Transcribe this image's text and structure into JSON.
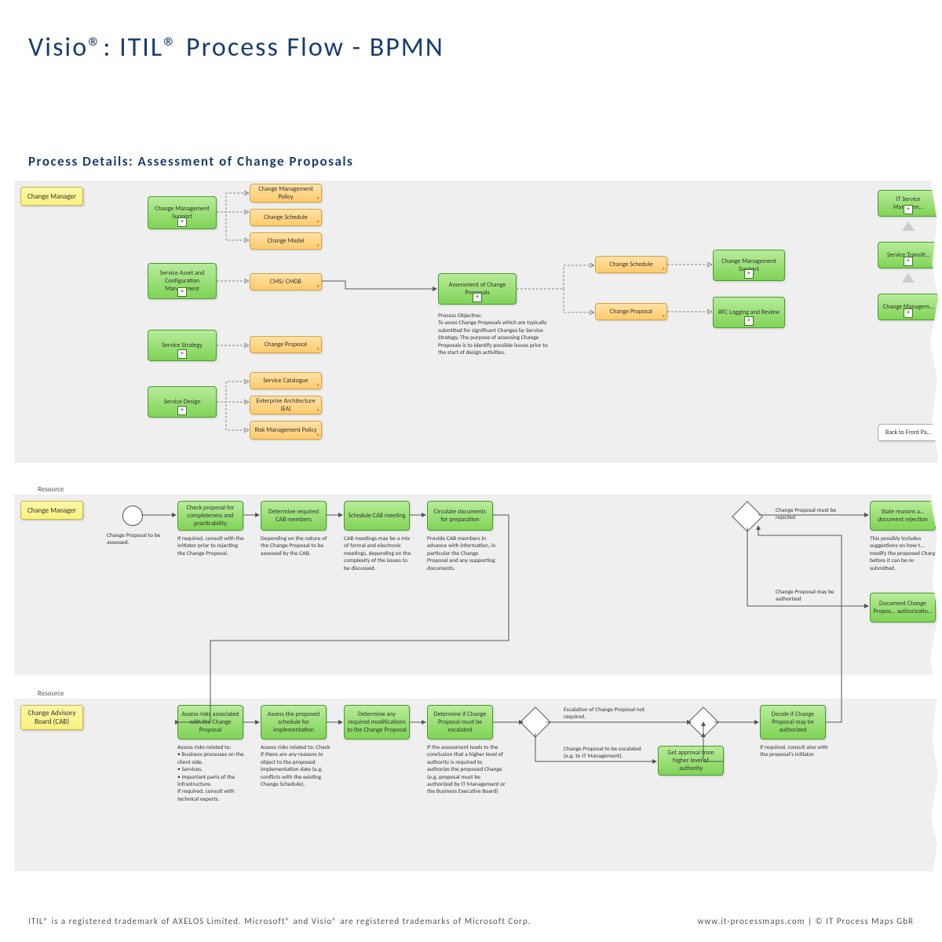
{
  "title": "Visio®: ITIL® Process Flow - BPMN",
  "subtitle": "Process Details: Assessment of Change Proposals",
  "lanes": {
    "cm1": "Change Manager",
    "res": "Resource",
    "cm2": "Change Manager",
    "cab": "Change Advisory Board (CAB)"
  },
  "top": {
    "g_cms": "Change Management Support",
    "g_sacm": "Service Asset and Configuration Management",
    "g_ss": "Service Strategy",
    "g_sd": "Service Design",
    "o_cmp": "Change Management Policy",
    "o_csched": "Change Schedule",
    "o_cmodel": "Change Model",
    "o_cmdb": "CMS/ CMDB",
    "o_cprop": "Change Proposal",
    "o_scat": "Service Catalogue",
    "o_ea": "Enterprise Architecture (EA)",
    "o_risk": "Risk Management Policy",
    "central": "Assessment of Change Proposals",
    "obj": "Process Objective:\nTo asses Change Proposals which are typically submitted for significant Changes by Service Strategy. The purpose of assessing Change Proposals is to identify possible issues prior to the start of design activities.",
    "o_csched2": "Change Schedule",
    "o_cprop2": "Change Proposal",
    "g_cms2": "Change Management Support",
    "g_rfc": "RFC Logging and Review",
    "r_itsm": "IT Service Managem…",
    "r_st": "Service Transiti…",
    "r_cm": "Change Managem…",
    "back": "Back to Front Pa…"
  },
  "mid": {
    "start_note": "Change Proposal to be assessed.",
    "a1": "Check proposal for completeness and practicability",
    "n1": "If required, consult with the initiator prior to rejecting the Change Proposal.",
    "a2": "Determine required CAB members",
    "n2": "Depending on the nature of the Change Proposal to be assessed by the CAB.",
    "a3": "Schedule CAB meeting",
    "n3": "CAB meetings may be a mix of formal and electronic meetings, depending on the complexity of the issues to be discussed.",
    "a4": "Circulate documents for preparation",
    "n4": "Provide CAB members in advance with information, in particular the Change Proposal and any supporting documents.",
    "rej": "Change Proposal must be rejected",
    "auth": "Change Proposal may be authorized",
    "out1": "State reasons a… document rejection",
    "out1n": "This possibly includes suggestions on how t… modify the proposed Change before it can be re-submitted.",
    "out2": "Document Change Propos… authorizatio…"
  },
  "bot": {
    "b1": "Assess risks associated with the Change Proposal",
    "bn1": "Assess risks related to:\n• Business processes on the client side.\n• Services.\n• Important parts of the infrastructure.\nIf required, consult with technical experts.",
    "b2": "Assess the proposed schedule for implementation",
    "bn2": "Assess risks related to: Check if there are any reasons to object to the proposed implementation date (e.g. conflicts with the existing Change Schedule).",
    "b3": "Determine any required modifications to the Change Proposal",
    "b4": "Determine if Change Proposal must be escalated",
    "bn4": "If the assessment leads to the conclusion that a higher level of authority is required to authorize the proposed Change (e.g. proposal must be authorized by IT Management or the Business Executive Board)",
    "esc_no": "Escalation of Change Proposal not required.",
    "esc_yes": "Change Proposal to be escalated (e.g. to IT Management).",
    "b5": "Get approval from higher level of authority",
    "b6": "Decide if Change Proposal may be authorized",
    "bn6": "If required, consult also with the proposal's initiator."
  },
  "footer": {
    "left": "ITIL® is a registered trademark of AXELOS Limited. Microsoft® and Visio® are registered trademarks of Microsoft Corp.",
    "right": "www.it-processmaps.com | © IT Process Maps GbR"
  }
}
